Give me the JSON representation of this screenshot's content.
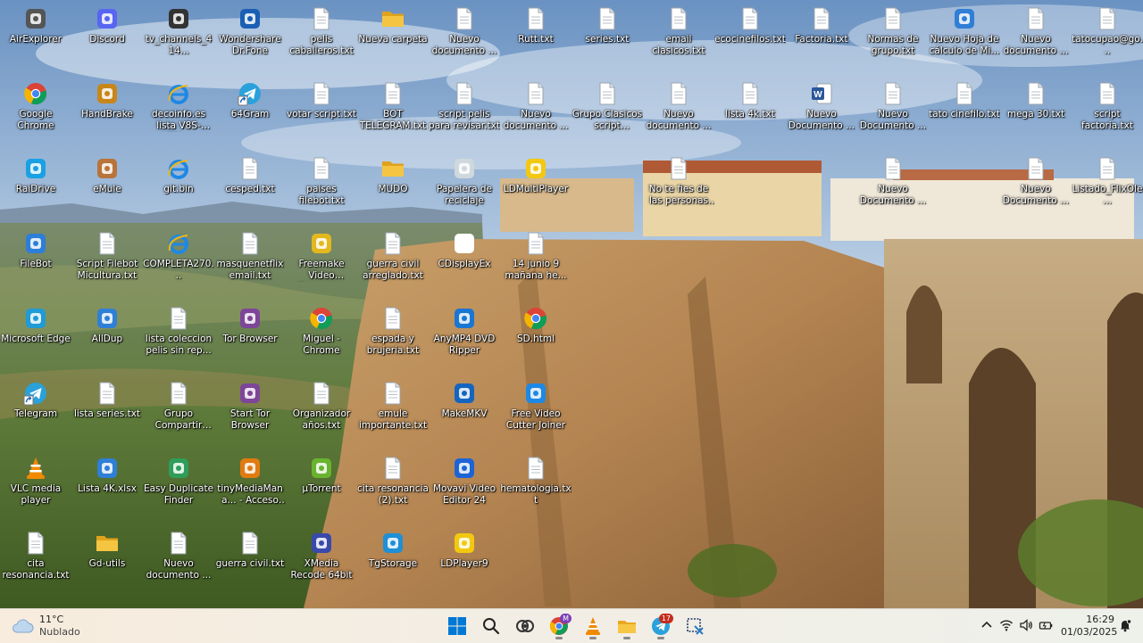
{
  "desktop": {
    "icons": [
      {
        "label": "AirExplorer",
        "kind": "app",
        "icon": "air-explorer-icon",
        "color": "#555555"
      },
      {
        "label": "Google Chrome",
        "kind": "chrome",
        "icon": "chrome-icon",
        "color": "#4285f4"
      },
      {
        "label": "RaiDrive",
        "kind": "app",
        "icon": "raidrive-icon",
        "color": "#1aa1e3"
      },
      {
        "label": "FileBot",
        "kind": "app",
        "icon": "filebot-icon",
        "color": "#2d7ed8"
      },
      {
        "label": "Microsoft Edge",
        "kind": "app",
        "icon": "edge-icon",
        "color": "#1f9bd6"
      },
      {
        "label": "Telegram",
        "kind": "shortcut",
        "icon": "telegram-icon",
        "color": "#2aa1da"
      },
      {
        "label": "VLC media player",
        "kind": "vlc",
        "icon": "vlc-icon",
        "color": "#f08a00"
      },
      {
        "label": "cita resonancia.txt",
        "kind": "txt",
        "icon": "text-file-icon",
        "color": "#ffffff"
      },
      {
        "label": "Discord",
        "kind": "app",
        "icon": "discord-icon",
        "color": "#5865f2"
      },
      {
        "label": "HandBrake",
        "kind": "app",
        "icon": "handbrake-icon",
        "color": "#c8861a"
      },
      {
        "label": "eMule",
        "kind": "app",
        "icon": "emule-icon",
        "color": "#b8743a"
      },
      {
        "label": "Script Filebot Micultura.txt",
        "kind": "txt",
        "icon": "text-file-icon",
        "color": "#ffffff"
      },
      {
        "label": "AllDup",
        "kind": "app",
        "icon": "alldup-icon",
        "color": "#2f7fd6"
      },
      {
        "label": "lista series.txt",
        "kind": "txt",
        "icon": "text-file-icon",
        "color": "#ffffff"
      },
      {
        "label": "Lista 4K.xlsx",
        "kind": "app",
        "icon": "spreadsheet-icon",
        "color": "#2f7fd6"
      },
      {
        "label": "Gd-utils",
        "kind": "folder",
        "icon": "folder-icon",
        "color": "#f5c542"
      },
      {
        "label": "tv_channels_414...",
        "kind": "app",
        "icon": "media-file-icon",
        "color": "#333333"
      },
      {
        "label": "decoinfo.es lista V8S-V8No...",
        "kind": "ie",
        "icon": "internet-explorer-icon",
        "color": "#1e88e5"
      },
      {
        "label": "git.bin",
        "kind": "ie",
        "icon": "internet-explorer-icon",
        "color": "#1e88e5"
      },
      {
        "label": "COMPLETA270...",
        "kind": "ie",
        "icon": "internet-explorer-icon",
        "color": "#1e88e5"
      },
      {
        "label": "lista coleccion pelis sin rep...",
        "kind": "txt",
        "icon": "text-file-icon",
        "color": "#ffffff"
      },
      {
        "label": "Grupo Compartir 2.txt",
        "kind": "txt",
        "icon": "text-file-icon",
        "color": "#ffffff"
      },
      {
        "label": "Easy Duplicate Finder",
        "kind": "app",
        "icon": "duplicate-finder-icon",
        "color": "#2e9e5a"
      },
      {
        "label": "Nuevo documento ...",
        "kind": "txt",
        "icon": "text-file-icon",
        "color": "#ffffff"
      },
      {
        "label": "Wondershare Dr.Fone",
        "kind": "app",
        "icon": "drfone-icon",
        "color": "#1a5fb4"
      },
      {
        "label": "64Gram",
        "kind": "shortcut",
        "icon": "telegram-icon",
        "color": "#2aa1da"
      },
      {
        "label": "cesped.txt",
        "kind": "txt",
        "icon": "text-file-icon",
        "color": "#ffffff"
      },
      {
        "label": "masquenetflix email.txt",
        "kind": "txt",
        "icon": "text-file-icon",
        "color": "#ffffff"
      },
      {
        "label": "Tor Browser",
        "kind": "app",
        "icon": "tor-browser-icon",
        "color": "#7d4698"
      },
      {
        "label": "Start Tor Browser",
        "kind": "app",
        "icon": "tor-browser-icon",
        "color": "#7d4698"
      },
      {
        "label": "tinyMediaMana... - Acceso directo",
        "kind": "app",
        "icon": "tinymediamanager-icon",
        "color": "#e07b12"
      },
      {
        "label": "guerra civil.txt",
        "kind": "txt",
        "icon": "text-file-icon",
        "color": "#ffffff"
      },
      {
        "label": "pelis caballeros.txt",
        "kind": "txt",
        "icon": "text-file-icon",
        "color": "#ffffff"
      },
      {
        "label": "votar script.txt",
        "kind": "txt",
        "icon": "text-file-icon",
        "color": "#ffffff"
      },
      {
        "label": "paises filebot.txt",
        "kind": "txt",
        "icon": "text-file-icon",
        "color": "#ffffff"
      },
      {
        "label": "Freemake Video Converter",
        "kind": "app",
        "icon": "freemake-icon",
        "color": "#e3b81f"
      },
      {
        "label": "Miguel - Chrome",
        "kind": "chrome",
        "icon": "chrome-icon",
        "color": "#4285f4"
      },
      {
        "label": "Organizador años.txt",
        "kind": "txt",
        "icon": "text-file-icon",
        "color": "#ffffff"
      },
      {
        "label": "µTorrent",
        "kind": "app",
        "icon": "utorrent-icon",
        "color": "#6ab32e"
      },
      {
        "label": "XMedia Recode 64bit",
        "kind": "app",
        "icon": "xmedia-recode-icon",
        "color": "#3949ab"
      },
      {
        "label": "Nueva carpeta",
        "kind": "folder",
        "icon": "folder-icon",
        "color": "#f5c542"
      },
      {
        "label": "BOT TELEGRAM.txt",
        "kind": "txt",
        "icon": "text-file-icon",
        "color": "#ffffff"
      },
      {
        "label": "MUDO",
        "kind": "folder",
        "icon": "folder-icon",
        "color": "#f5c542"
      },
      {
        "label": "guerra civil arreglado.txt",
        "kind": "txt",
        "icon": "text-file-icon",
        "color": "#ffffff"
      },
      {
        "label": "espada y brujeria.txt",
        "kind": "txt",
        "icon": "text-file-icon",
        "color": "#ffffff"
      },
      {
        "label": "emule importante.txt",
        "kind": "txt",
        "icon": "text-file-icon",
        "color": "#ffffff"
      },
      {
        "label": "cita resonancia (2).txt",
        "kind": "txt",
        "icon": "text-file-icon",
        "color": "#ffffff"
      },
      {
        "label": "TgStorage",
        "kind": "app",
        "icon": "tgstorage-icon",
        "color": "#1f8fd6"
      },
      {
        "label": "Nuevo documento ...",
        "kind": "txt",
        "icon": "text-file-icon",
        "color": "#ffffff"
      },
      {
        "label": "script pelis para revisar.txt",
        "kind": "txt",
        "icon": "text-file-icon",
        "color": "#ffffff"
      },
      {
        "label": "Papelera de reciclaje",
        "kind": "app",
        "icon": "recycle-bin-icon",
        "color": "#cfd8dc"
      },
      {
        "label": "CDisplayEx",
        "kind": "app",
        "icon": "cdisplayex-icon",
        "color": "#ffffff"
      },
      {
        "label": "AnyMP4 DVD Ripper",
        "kind": "app",
        "icon": "anymp4-icon",
        "color": "#1976d2"
      },
      {
        "label": "MakeMKV",
        "kind": "app",
        "icon": "makemkv-icon",
        "color": "#1565c0"
      },
      {
        "label": "Movavi Video Editor 24",
        "kind": "app",
        "icon": "movavi-icon",
        "color": "#1e63d6"
      },
      {
        "label": "LDPlayer9",
        "kind": "app",
        "icon": "ldplayer-icon",
        "color": "#f2c811"
      },
      {
        "label": "Rutt.txt",
        "kind": "txt",
        "icon": "text-file-icon",
        "color": "#ffffff"
      },
      {
        "label": "Nuevo documento ...",
        "kind": "txt",
        "icon": "text-file-icon",
        "color": "#ffffff"
      },
      {
        "label": "LDMultiPlayer",
        "kind": "app",
        "icon": "ldmultiplayer-icon",
        "color": "#f2c811"
      },
      {
        "label": "14 junio 9 mañana he...",
        "kind": "txt",
        "icon": "text-file-icon",
        "color": "#ffffff"
      },
      {
        "label": "SD.html",
        "kind": "chrome",
        "icon": "chrome-icon",
        "color": "#4285f4"
      },
      {
        "label": "Free Video Cutter Joiner",
        "kind": "app",
        "icon": "video-cutter-icon",
        "color": "#1e88e5"
      },
      {
        "label": "hematologia.txt",
        "kind": "txt",
        "icon": "text-file-icon",
        "color": "#ffffff"
      },
      {
        "label": "series.txt",
        "kind": "txt",
        "icon": "text-file-icon",
        "color": "#ffffff"
      },
      {
        "label": "Grupo Clasicos script series.txt",
        "kind": "txt",
        "icon": "text-file-icon",
        "color": "#ffffff"
      },
      {
        "label": "email clasicos.txt",
        "kind": "txt",
        "icon": "text-file-icon",
        "color": "#ffffff"
      },
      {
        "label": "Nuevo documento ...",
        "kind": "txt",
        "icon": "text-file-icon",
        "color": "#ffffff"
      },
      {
        "label": "No te fies de las personas que n...",
        "kind": "txt",
        "icon": "text-file-icon",
        "color": "#ffffff"
      },
      {
        "label": "ecocinefilos.txt",
        "kind": "txt",
        "icon": "text-file-icon",
        "color": "#ffffff"
      },
      {
        "label": "lista 4k.txt",
        "kind": "txt",
        "icon": "text-file-icon",
        "color": "#ffffff"
      },
      {
        "label": "Factoria.txt",
        "kind": "txt",
        "icon": "text-file-icon",
        "color": "#ffffff"
      },
      {
        "label": "Nuevo Documento ...",
        "kind": "word",
        "icon": "word-document-icon",
        "color": "#2b579a"
      },
      {
        "label": "Normas de grupo.txt",
        "kind": "txt",
        "icon": "text-file-icon",
        "color": "#ffffff"
      },
      {
        "label": "Nuevo Documento ...",
        "kind": "txt",
        "icon": "text-file-icon",
        "color": "#ffffff"
      },
      {
        "label": "Nuevo Documento ...",
        "kind": "txt",
        "icon": "text-file-icon",
        "color": "#ffffff"
      },
      {
        "label": "Nuevo Hoja de cálculo de Mi...",
        "kind": "app",
        "icon": "spreadsheet-icon",
        "color": "#2f7fd6"
      },
      {
        "label": "tato cinefilo.txt",
        "kind": "txt",
        "icon": "text-file-icon",
        "color": "#ffffff"
      },
      {
        "label": "Nuevo documento ...",
        "kind": "txt",
        "icon": "text-file-icon",
        "color": "#ffffff"
      },
      {
        "label": "mega 30.txt",
        "kind": "txt",
        "icon": "text-file-icon",
        "color": "#ffffff"
      },
      {
        "label": "Nuevo Documento ...",
        "kind": "txt",
        "icon": "text-file-icon",
        "color": "#ffffff"
      },
      {
        "label": "tatocupao@go...",
        "kind": "txt",
        "icon": "text-file-icon",
        "color": "#ffffff"
      },
      {
        "label": "script factoria.txt",
        "kind": "txt",
        "icon": "text-file-icon",
        "color": "#ffffff"
      },
      {
        "label": "Listado_FlixOle...",
        "kind": "txt",
        "icon": "text-file-icon",
        "color": "#ffffff"
      }
    ]
  },
  "weather": {
    "temp": "11°C",
    "condition": "Nublado",
    "icon": "cloud-icon"
  },
  "taskbar": {
    "apps": [
      {
        "name": "start-button",
        "icon": "windows-logo-icon"
      },
      {
        "name": "search-button",
        "icon": "search-icon"
      },
      {
        "name": "taskbar-airexplorer",
        "icon": "air-explorer-icon"
      },
      {
        "name": "taskbar-chrome",
        "icon": "chrome-icon",
        "running": true
      },
      {
        "name": "taskbar-vlc",
        "icon": "vlc-icon",
        "running": true
      },
      {
        "name": "taskbar-file-explorer",
        "icon": "folder-icon",
        "running": true
      },
      {
        "name": "taskbar-telegram",
        "icon": "telegram-icon",
        "badge": "17",
        "running": true
      },
      {
        "name": "taskbar-snipping",
        "icon": "snipping-tool-icon"
      }
    ],
    "chrome_badge": "M"
  },
  "tray": {
    "icons": [
      "chevron-up-icon",
      "wifi-icon",
      "speaker-icon",
      "battery-icon"
    ]
  },
  "clock": {
    "time": "16:29",
    "date": "01/03/2025"
  },
  "colors": {
    "accent": "#0067c0",
    "txt_file": "#ffffff",
    "folder": "#f5c542"
  }
}
